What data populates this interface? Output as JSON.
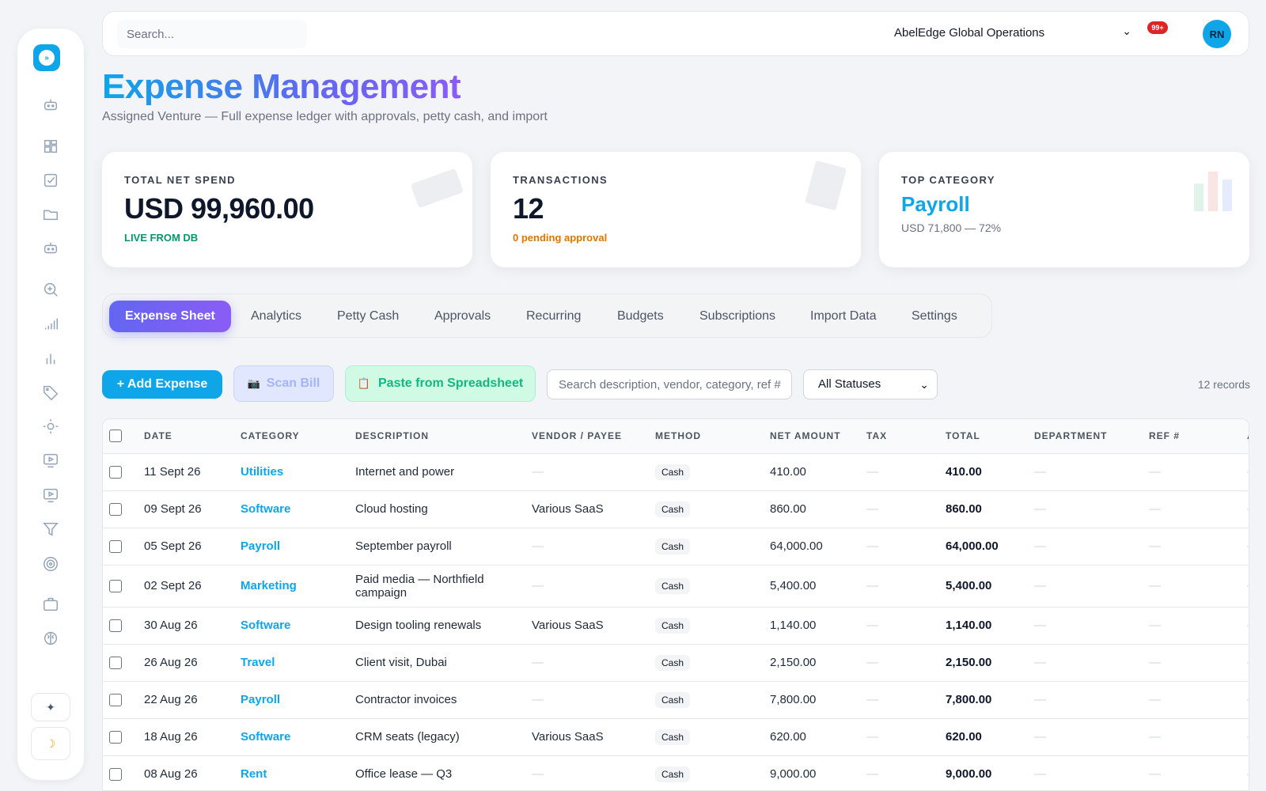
{
  "header": {
    "search_placeholder": "Search...",
    "org": "AbelEdge Global Operations",
    "notifications": "99+",
    "avatar_initials": "RN"
  },
  "page": {
    "title": "Expense Management",
    "subtitle": "Assigned Venture — Full expense ledger with approvals, petty cash, and import"
  },
  "stats": {
    "spend": {
      "label": "TOTAL NET SPEND",
      "value": "USD 99,960.00",
      "note": "LIVE FROM DB",
      "note_color": "#059669"
    },
    "transactions": {
      "label": "TRANSACTIONS",
      "value": "12",
      "note": "0 pending approval",
      "note_color": "#d97706"
    },
    "top_category": {
      "label": "TOP CATEGORY",
      "value": "Payroll",
      "note": "USD 71,800 — 72%"
    }
  },
  "tabs": [
    "Expense Sheet",
    "Analytics",
    "Petty Cash",
    "Approvals",
    "Recurring",
    "Budgets",
    "Subscriptions",
    "Import Data",
    "Settings"
  ],
  "toolbar": {
    "add_label": "+ Add Expense",
    "scan_label": "Scan Bill",
    "paste_label": "Paste from Spreadsheet",
    "filter_placeholder": "Search description, vendor, category, ref #",
    "status_value": "All Statuses",
    "records": "12 records"
  },
  "table": {
    "columns": [
      "DATE",
      "CATEGORY",
      "DESCRIPTION",
      "VENDOR / PAYEE",
      "METHOD",
      "NET AMOUNT",
      "TAX",
      "TOTAL",
      "DEPARTMENT",
      "REF #",
      "A"
    ],
    "rows": [
      {
        "date": "11 Sept 26",
        "category": "Utilities",
        "description": "Internet and power",
        "vendor": "—",
        "method": "Cash",
        "net": "410.00",
        "tax": "—",
        "total": "410.00",
        "department": "—",
        "ref": "—"
      },
      {
        "date": "09 Sept 26",
        "category": "Software",
        "description": "Cloud hosting",
        "vendor": "Various SaaS",
        "method": "Cash",
        "net": "860.00",
        "tax": "—",
        "total": "860.00",
        "department": "—",
        "ref": "—"
      },
      {
        "date": "05 Sept 26",
        "category": "Payroll",
        "description": "September payroll",
        "vendor": "—",
        "method": "Cash",
        "net": "64,000.00",
        "tax": "—",
        "total": "64,000.00",
        "department": "—",
        "ref": "—"
      },
      {
        "date": "02 Sept 26",
        "category": "Marketing",
        "description": "Paid media — Northfield campaign",
        "vendor": "—",
        "method": "Cash",
        "net": "5,400.00",
        "tax": "—",
        "total": "5,400.00",
        "department": "—",
        "ref": "—"
      },
      {
        "date": "30 Aug 26",
        "category": "Software",
        "description": "Design tooling renewals",
        "vendor": "Various SaaS",
        "method": "Cash",
        "net": "1,140.00",
        "tax": "—",
        "total": "1,140.00",
        "department": "—",
        "ref": "—"
      },
      {
        "date": "26 Aug 26",
        "category": "Travel",
        "description": "Client visit, Dubai",
        "vendor": "—",
        "method": "Cash",
        "net": "2,150.00",
        "tax": "—",
        "total": "2,150.00",
        "department": "—",
        "ref": "—"
      },
      {
        "date": "22 Aug 26",
        "category": "Payroll",
        "description": "Contractor invoices",
        "vendor": "—",
        "method": "Cash",
        "net": "7,800.00",
        "tax": "—",
        "total": "7,800.00",
        "department": "—",
        "ref": "—"
      },
      {
        "date": "18 Aug 26",
        "category": "Software",
        "description": "CRM seats (legacy)",
        "vendor": "Various SaaS",
        "method": "Cash",
        "net": "620.00",
        "tax": "—",
        "total": "620.00",
        "department": "—",
        "ref": "—"
      },
      {
        "date": "08 Aug 26",
        "category": "Rent",
        "description": "Office lease — Q3",
        "vendor": "—",
        "method": "Cash",
        "net": "9,000.00",
        "tax": "—",
        "total": "9,000.00",
        "department": "—",
        "ref": "—"
      }
    ]
  },
  "colors": {
    "accent": "#0ea5e9",
    "tab_gradient_start": "#6366f1",
    "tab_gradient_end": "#8b5cf6"
  },
  "sidebar": {
    "icons": [
      "bot-icon",
      "dashboard-grid-icon",
      "checkbox-icon",
      "folder-icon",
      "bot-icon",
      "zoom-in-icon",
      "signal-bars-icon",
      "bar-chart-icon",
      "tag-icon",
      "sun-icon",
      "monitor-play-icon",
      "monitor-play-icon",
      "filter-icon",
      "target-icon",
      "briefcase-icon",
      "brain-icon"
    ]
  }
}
